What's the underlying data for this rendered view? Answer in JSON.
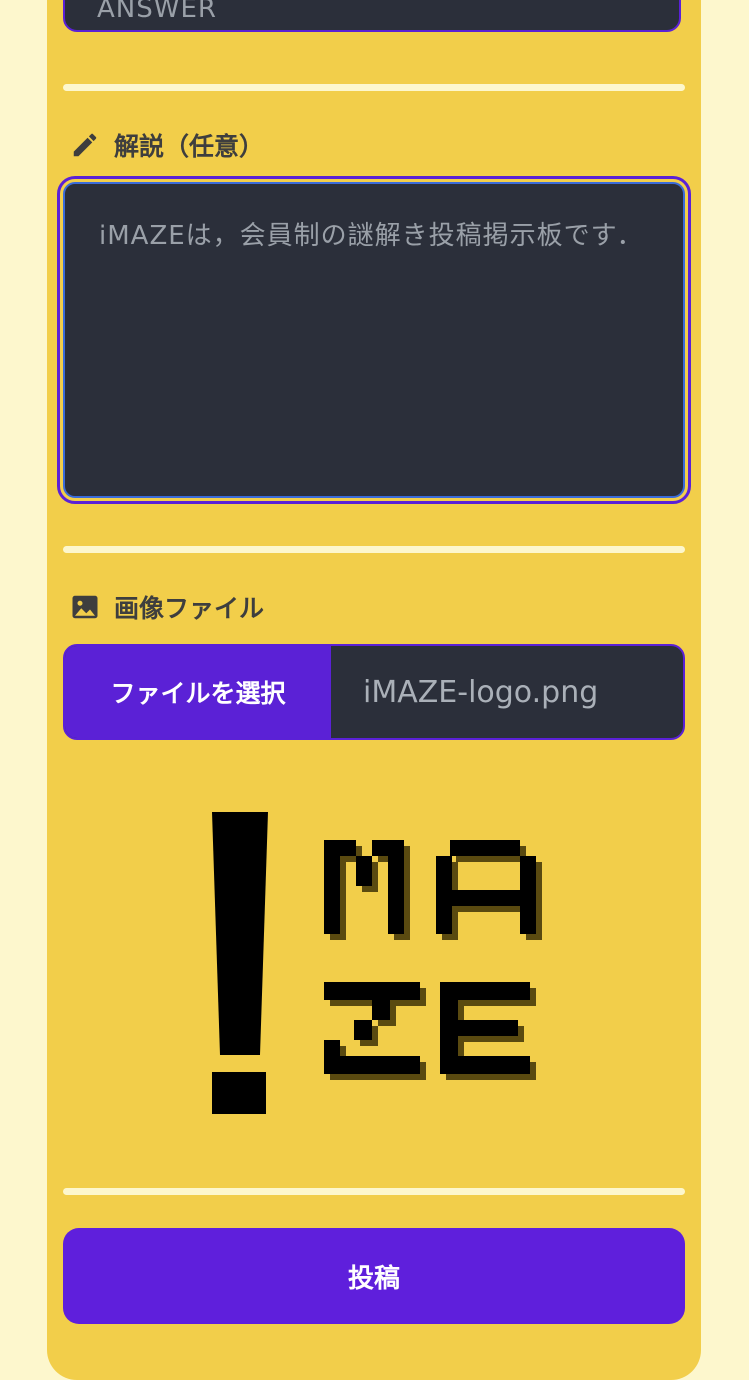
{
  "answer_field": {
    "value": "ANSWER"
  },
  "explanation": {
    "label": "解説（任意）",
    "icon": "pencil-icon",
    "value": "iMAZEは，会員制の謎解き投稿掲示板です．"
  },
  "image_file": {
    "label": "画像ファイル",
    "icon": "image-icon",
    "choose_button": "ファイルを選択",
    "file_name": "iMAZE-logo.png",
    "preview_logo_text": "iMAZE"
  },
  "submit_button": "投稿",
  "colors": {
    "page_background": "#fdf7cd",
    "card": "#f2ce4a",
    "input_background": "#2b2f3a",
    "accent": "#5b21d6",
    "focus_ring": "#3a6bd9"
  }
}
